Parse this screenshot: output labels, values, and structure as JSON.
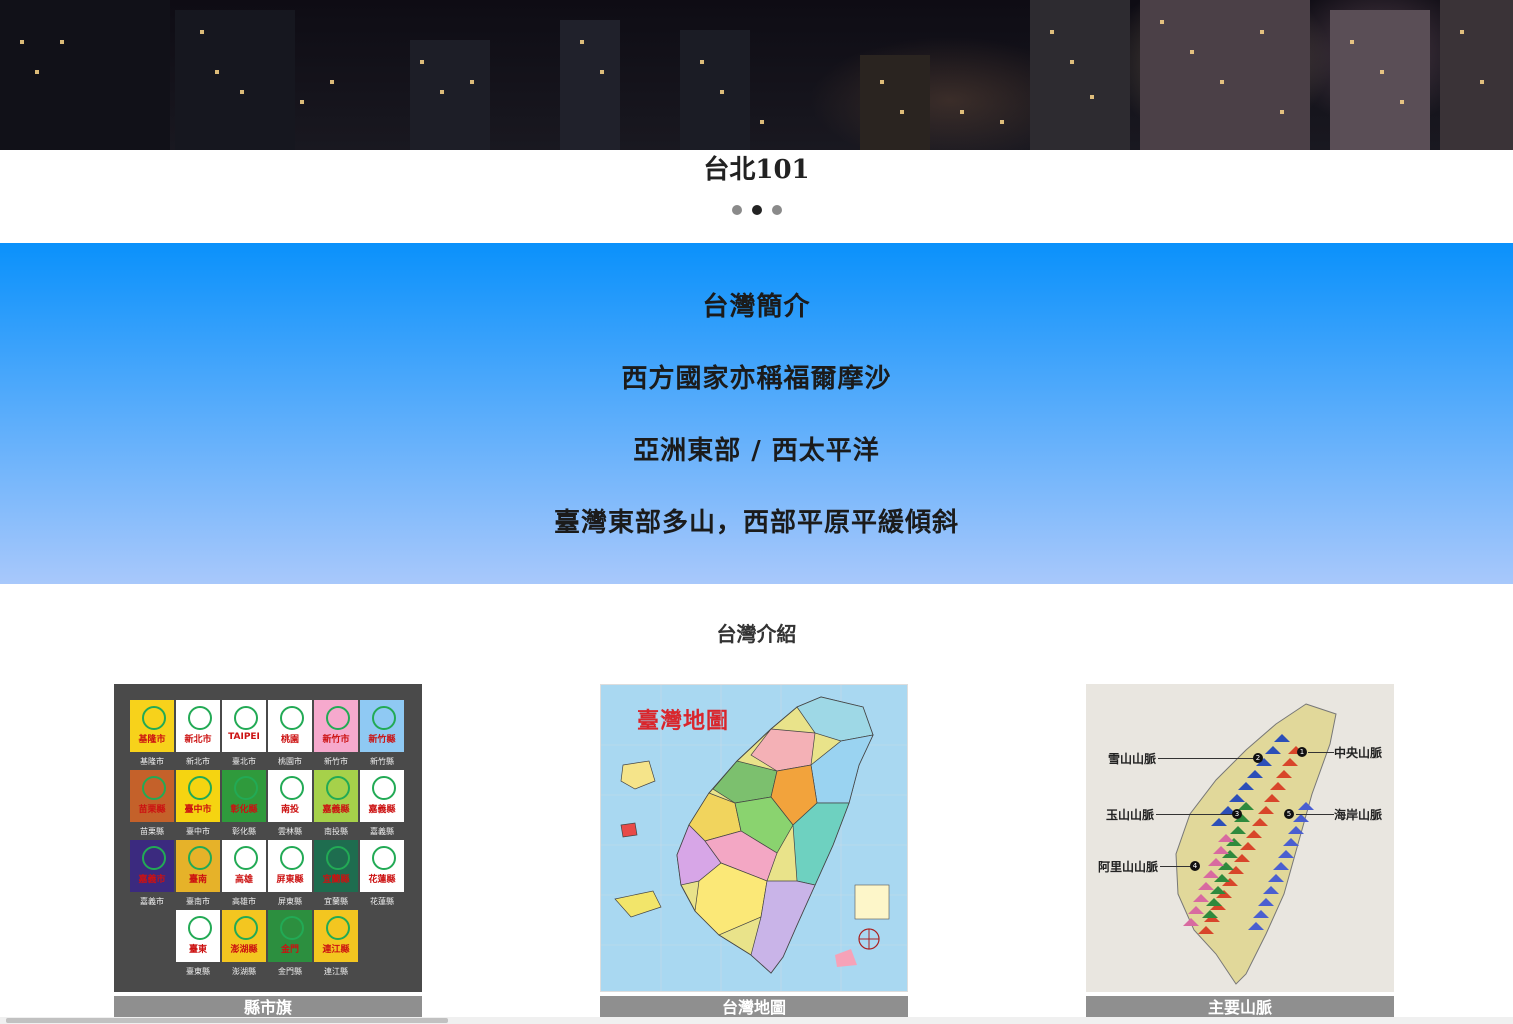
{
  "carousel": {
    "caption": "台北101",
    "slide_count": 3,
    "active_index": 1
  },
  "intro": {
    "lines": [
      "台灣簡介",
      "西方國家亦稱福爾摩沙",
      "亞洲東部 / 西太平洋",
      "臺灣東部多山，西部平原平緩傾斜"
    ]
  },
  "gallery": {
    "title": "台灣介紹",
    "cards": [
      {
        "label": "縣市旗",
        "flags": [
          {
            "text": "基隆市",
            "name": "基隆市",
            "color": "#f7d21b"
          },
          {
            "text": "新北市",
            "name": "新北市",
            "color": "#ffffff"
          },
          {
            "text": "TAIPEI",
            "name": "臺北市",
            "color": "#ffffff"
          },
          {
            "text": "桃園",
            "name": "桃園市",
            "color": "#ffffff"
          },
          {
            "text": "新竹市",
            "name": "新竹市",
            "color": "#f6a9cd"
          },
          {
            "text": "新竹縣",
            "name": "新竹縣",
            "color": "#8fc9f3"
          },
          {
            "text": "苗栗縣",
            "name": "苗栗縣",
            "color": "#c4612a"
          },
          {
            "text": "臺中市",
            "name": "臺中市",
            "color": "#f5d411"
          },
          {
            "text": "彰化縣",
            "name": "彰化縣",
            "color": "#2f9a3c"
          },
          {
            "text": "南投",
            "name": "雲林縣",
            "color": "#ffffff"
          },
          {
            "text": "嘉義縣",
            "name": "南投縣",
            "color": "#a6d14a"
          },
          {
            "text": "嘉義縣",
            "name": "嘉義縣",
            "color": "#ffffff"
          },
          {
            "text": "嘉義市",
            "name": "嘉義市",
            "color": "#3b2a7f"
          },
          {
            "text": "臺南",
            "name": "臺南市",
            "color": "#e6b229"
          },
          {
            "text": "高雄",
            "name": "高雄市",
            "color": "#ffffff"
          },
          {
            "text": "屏東縣",
            "name": "屏東縣",
            "color": "#ffffff"
          },
          {
            "text": "宜蘭縣",
            "name": "宜蘭縣",
            "color": "#1e6d4f"
          },
          {
            "text": "花蓮縣",
            "name": "花蓮縣",
            "color": "#ffffff"
          },
          {
            "text": "臺東",
            "name": "臺東縣",
            "color": "#ffffff"
          },
          {
            "text": "澎湖縣",
            "name": "澎湖縣",
            "color": "#f3c620"
          },
          {
            "text": "金門",
            "name": "金門縣",
            "color": "#2c8f3f"
          },
          {
            "text": "連江縣",
            "name": "連江縣",
            "color": "#f3c620"
          }
        ]
      },
      {
        "label": "台灣地圖",
        "map_title": "臺灣地圖"
      },
      {
        "label": "主要山脈",
        "ranges": [
          "中央山脈",
          "雪山山脈",
          "玉山山脈",
          "海岸山脈",
          "阿里山山脈"
        ]
      }
    ]
  },
  "colors": {
    "band_top": "#0a91fb",
    "band_bottom": "#a8c8fb",
    "label_bg": "#8f8f8f"
  }
}
